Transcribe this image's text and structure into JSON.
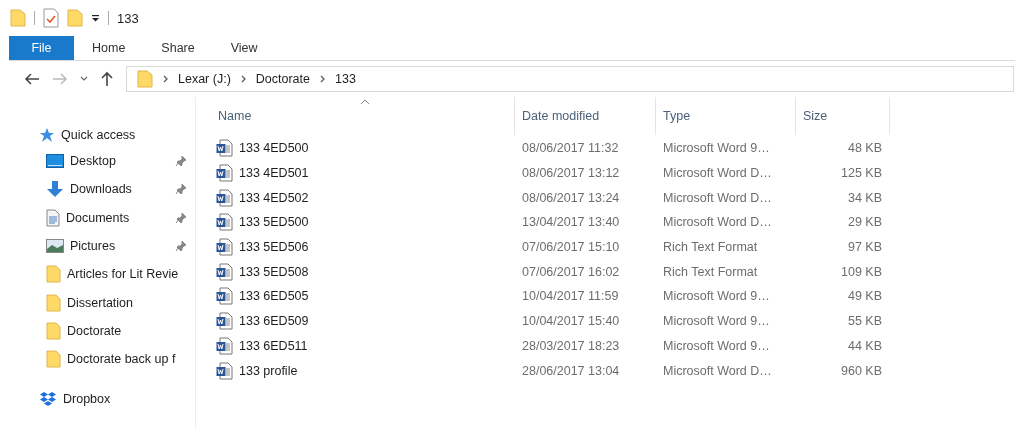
{
  "window": {
    "title": "133"
  },
  "ribbon_tabs": [
    {
      "label": "File",
      "selected": true
    },
    {
      "label": "Home",
      "selected": false
    },
    {
      "label": "Share",
      "selected": false
    },
    {
      "label": "View",
      "selected": false
    }
  ],
  "navigation": {
    "back_disabled": false,
    "forward_disabled": true
  },
  "address_bar": {
    "segments": [
      "Lexar (J:)",
      "Doctorate",
      "133"
    ]
  },
  "sidebar": {
    "quick_access": "Quick access",
    "items": [
      {
        "label": "Desktop",
        "kind": "desktop",
        "pinned": true
      },
      {
        "label": "Downloads",
        "kind": "downloads",
        "pinned": true
      },
      {
        "label": "Documents",
        "kind": "documents",
        "pinned": true
      },
      {
        "label": "Pictures",
        "kind": "pictures",
        "pinned": true
      },
      {
        "label": "Articles for Lit Revie",
        "kind": "folder",
        "pinned": false
      },
      {
        "label": "Dissertation",
        "kind": "folder",
        "pinned": false
      },
      {
        "label": "Doctorate",
        "kind": "folder",
        "pinned": false
      },
      {
        "label": "Doctorate back up f",
        "kind": "folder",
        "pinned": false
      }
    ],
    "dropbox": "Dropbox"
  },
  "table": {
    "columns": [
      {
        "label": "Name",
        "sorted": true
      },
      {
        "label": "Date modified",
        "sorted": false
      },
      {
        "label": "Type",
        "sorted": false
      },
      {
        "label": "Size",
        "sorted": false
      }
    ],
    "rows": [
      {
        "name": "133 4ED500",
        "date": "08/06/2017 11:32",
        "type": "Microsoft Word 9…",
        "size": "48 KB"
      },
      {
        "name": "133 4ED501",
        "date": "08/06/2017 13:12",
        "type": "Microsoft Word D…",
        "size": "125 KB"
      },
      {
        "name": "133 4ED502",
        "date": "08/06/2017 13:24",
        "type": "Microsoft Word D…",
        "size": "34 KB"
      },
      {
        "name": "133 5ED500",
        "date": "13/04/2017 13:40",
        "type": "Microsoft Word D…",
        "size": "29 KB"
      },
      {
        "name": "133 5ED506",
        "date": "07/06/2017 15:10",
        "type": "Rich Text Format",
        "size": "97 KB"
      },
      {
        "name": "133 5ED508",
        "date": "07/06/2017 16:02",
        "type": "Rich Text Format",
        "size": "109 KB"
      },
      {
        "name": "133 6ED505",
        "date": "10/04/2017 11:59",
        "type": "Microsoft Word 9…",
        "size": "49 KB"
      },
      {
        "name": "133 6ED509",
        "date": "10/04/2017 15:40",
        "type": "Microsoft Word 9…",
        "size": "55 KB"
      },
      {
        "name": "133 6ED511",
        "date": "28/03/2017 18:23",
        "type": "Microsoft Word 9…",
        "size": "44 KB"
      },
      {
        "name": "133 profile",
        "date": "28/06/2017 13:04",
        "type": "Microsoft Word D…",
        "size": "960 KB"
      }
    ]
  }
}
